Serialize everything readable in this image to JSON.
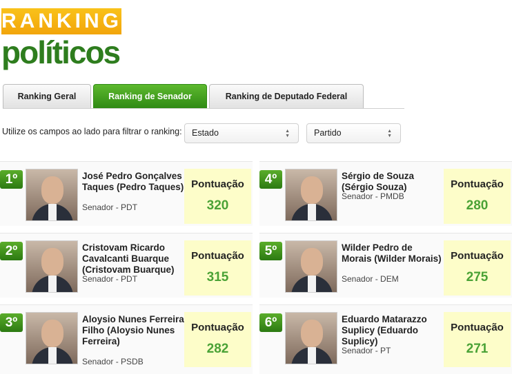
{
  "logo": {
    "top": "RANKING",
    "bottom": "políticos"
  },
  "tabs": [
    {
      "label": "Ranking Geral",
      "active": false
    },
    {
      "label": "Ranking de Senador",
      "active": true
    },
    {
      "label": "Ranking de Deputado Federal",
      "active": false
    }
  ],
  "filters": {
    "label": "Utilize os campos ao lado para filtrar o ranking:",
    "estado": "Estado",
    "partido": "Partido"
  },
  "score_label": "Pontuação",
  "rankings": [
    {
      "rank": "1º",
      "name": "José Pedro Gonçalves Taques (Pedro Taques)",
      "role": "Senador - PDT",
      "score": "320"
    },
    {
      "rank": "2º",
      "name": "Cristovam Ricardo Cavalcanti Buarque (Cristovam Buarque)",
      "role": "Senador - PDT",
      "score": "315"
    },
    {
      "rank": "3º",
      "name": "Aloysio Nunes Ferreira Filho (Aloysio Nunes Ferreira)",
      "role": "Senador - PSDB",
      "score": "282"
    },
    {
      "rank": "4º",
      "name": "Sérgio de Souza (Sérgio Souza)",
      "role": "Senador - PMDB",
      "score": "280"
    },
    {
      "rank": "5º",
      "name": "Wilder Pedro de Morais (Wilder Morais)",
      "role": "Senador - DEM",
      "score": "275"
    },
    {
      "rank": "6º",
      "name": "Eduardo Matarazzo Suplicy (Eduardo Suplicy)",
      "role": "Senador - PT",
      "score": "271"
    }
  ]
}
